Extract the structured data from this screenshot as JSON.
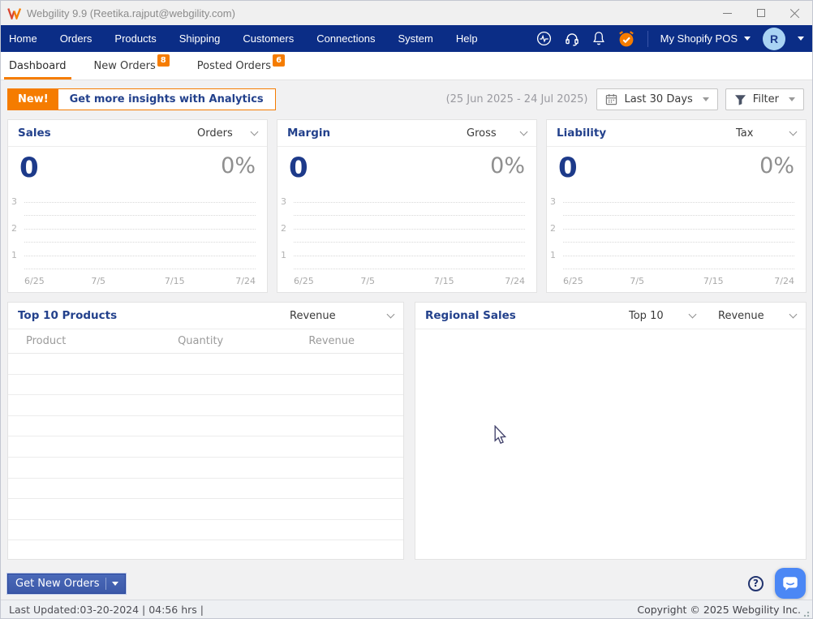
{
  "colors": {
    "menu_navy": "#0b2d86",
    "accent_orange": "#f57c00",
    "title_navy": "#23418c",
    "value_navy": "#1d3a8a",
    "button_blue": "#3c59a9",
    "chat_blue": "#4b87f5",
    "avatar_blue": "#a9d3f3"
  },
  "window": {
    "title": "Webgility 9.9 (Reetika.rajput@webgility.com)"
  },
  "menu": {
    "items": [
      "Home",
      "Orders",
      "Products",
      "Shipping",
      "Customers",
      "Connections",
      "System",
      "Help"
    ],
    "right_icons": [
      "activity-icon",
      "headset-icon",
      "bell-icon",
      "alarm-check-icon"
    ],
    "store_selector": "My Shopify POS",
    "avatar_initial": "R"
  },
  "tabs": {
    "dashboard": "Dashboard",
    "new_orders": "New Orders",
    "new_orders_badge": "8",
    "posted_orders": "Posted Orders",
    "posted_orders_badge": "6"
  },
  "toolbar": {
    "new_badge": "New!",
    "analytics_label": "Get more insights with Analytics",
    "date_range": "(25 Jun 2025 - 24 Jul 2025)",
    "date_filter_label": "Last 30 Days",
    "filter_label": "Filter"
  },
  "kpi_cards": [
    {
      "title": "Sales",
      "metric": "Orders",
      "value": "0",
      "percent": "0%"
    },
    {
      "title": "Margin",
      "metric": "Gross",
      "value": "0",
      "percent": "0%"
    },
    {
      "title": "Liability",
      "metric": "Tax",
      "value": "0",
      "percent": "0%"
    }
  ],
  "chart_data": {
    "type": "line",
    "title": "Empty KPI trend mini-charts shown for Sales, Margin and Liability",
    "x": [
      "6/25",
      "7/5",
      "7/15",
      "7/24"
    ],
    "y_ticks": [
      "3",
      "2",
      "1"
    ],
    "ylim": [
      0,
      3.5
    ],
    "grid": "dotted horizontal gridlines",
    "legend": "none",
    "series": []
  },
  "top_products": {
    "title": "Top 10 Products",
    "metric": "Revenue",
    "columns": [
      "Product",
      "Quantity",
      "Revenue"
    ],
    "rows": []
  },
  "regional_sales": {
    "title": "Regional Sales",
    "count_filter": "Top 10",
    "metric": "Revenue"
  },
  "footer": {
    "get_new_orders": "Get New Orders"
  },
  "status_bar": {
    "last_updated": "Last Updated:03-20-2024 | 04:56 hrs |",
    "copyright": "Copyright © 2025 Webgility Inc."
  }
}
